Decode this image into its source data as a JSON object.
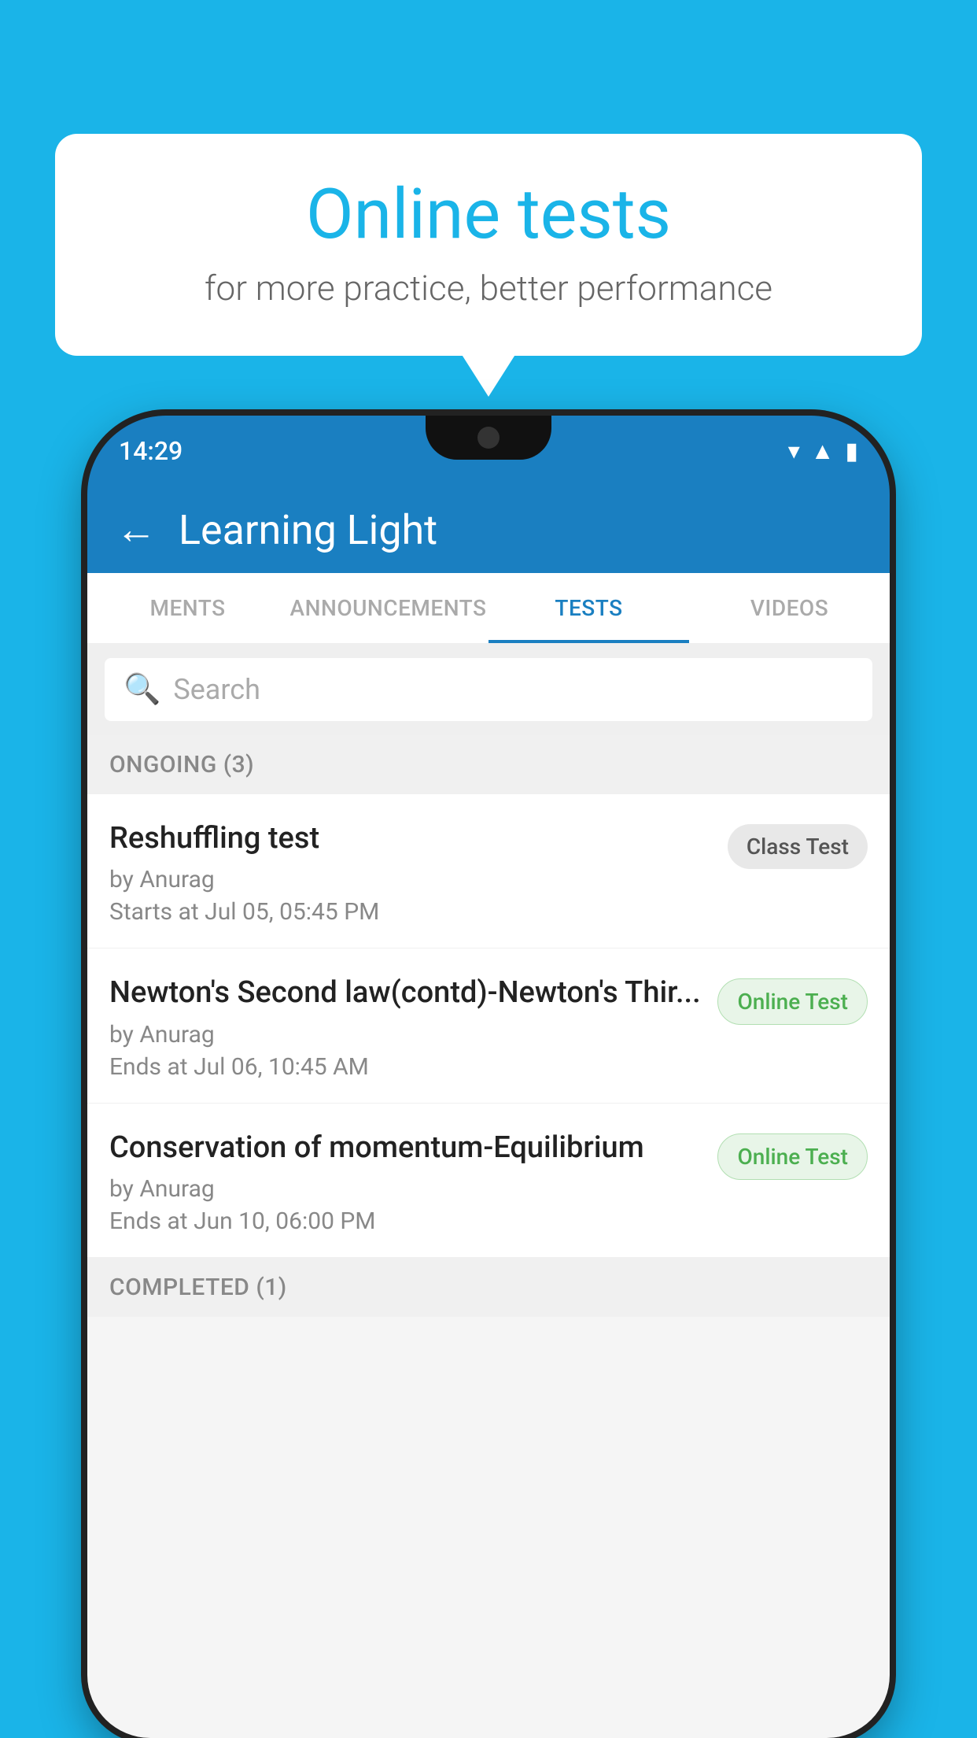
{
  "background": {
    "color": "#1ab4e8"
  },
  "speech_bubble": {
    "title": "Online tests",
    "subtitle": "for more practice, better performance"
  },
  "phone": {
    "status_bar": {
      "time": "14:29",
      "icons": [
        "wifi",
        "signal",
        "battery"
      ]
    },
    "app_bar": {
      "title": "Learning Light",
      "back_label": "←"
    },
    "tabs": [
      {
        "label": "MENTS",
        "active": false
      },
      {
        "label": "ANNOUNCEMENTS",
        "active": false
      },
      {
        "label": "TESTS",
        "active": true
      },
      {
        "label": "VIDEOS",
        "active": false
      }
    ],
    "search": {
      "placeholder": "Search"
    },
    "ongoing_section": {
      "label": "ONGOING (3)"
    },
    "test_items": [
      {
        "title": "Reshuffling test",
        "author": "by Anurag",
        "time_label": "Starts at",
        "time": "Jul 05, 05:45 PM",
        "badge": "Class Test",
        "badge_type": "class"
      },
      {
        "title": "Newton's Second law(contd)-Newton's Thir...",
        "author": "by Anurag",
        "time_label": "Ends at",
        "time": "Jul 06, 10:45 AM",
        "badge": "Online Test",
        "badge_type": "online"
      },
      {
        "title": "Conservation of momentum-Equilibrium",
        "author": "by Anurag",
        "time_label": "Ends at",
        "time": "Jun 10, 06:00 PM",
        "badge": "Online Test",
        "badge_type": "online"
      }
    ],
    "completed_section": {
      "label": "COMPLETED (1)"
    }
  }
}
